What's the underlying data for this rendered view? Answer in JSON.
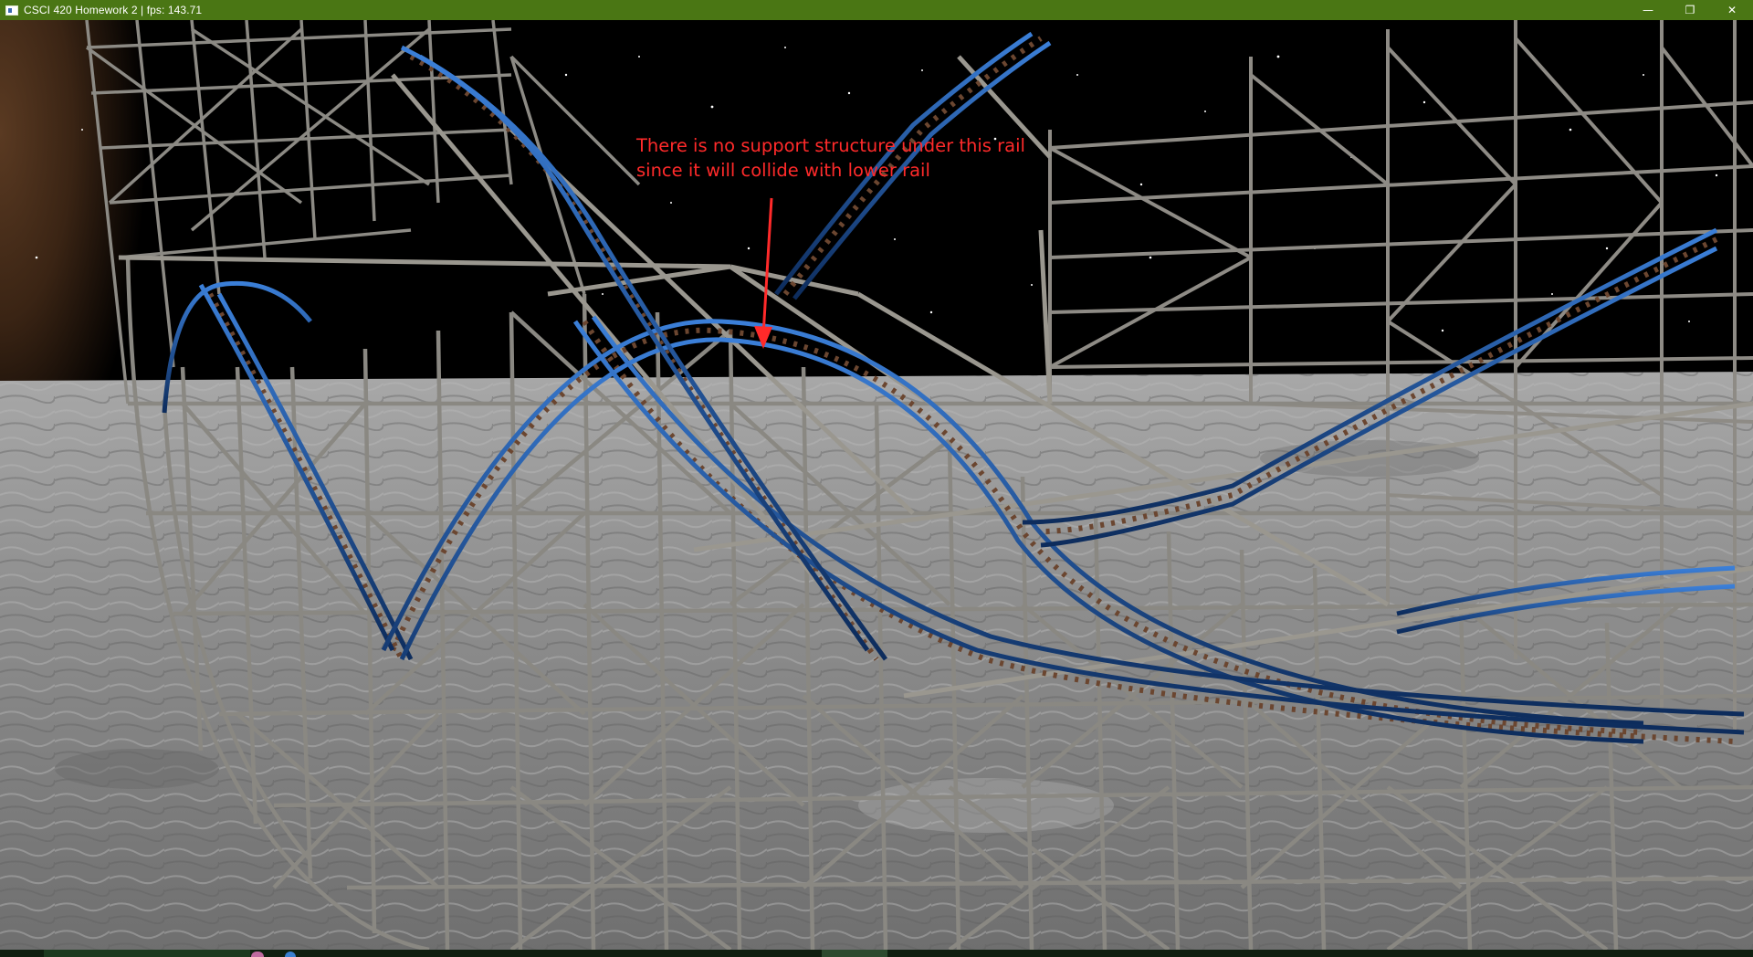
{
  "window": {
    "title": "CSCI 420 Homework 2 | fps: 143.71",
    "controls": {
      "minimize_glyph": "—",
      "maximize_glyph": "❐",
      "close_glyph": "✕"
    }
  },
  "scene": {
    "annotation_line1": "There is no support structure under this rail",
    "annotation_line2": "since it will collide with lower rail",
    "annotation_color": "#ff2a2a"
  },
  "colors": {
    "titlebar": "#4a7614",
    "rail_blue": "#1c4f9a",
    "tie_brown": "#6b4630",
    "support_grey": "#8c8a84",
    "ground": "#8a8a8a",
    "sky": "#000000"
  }
}
